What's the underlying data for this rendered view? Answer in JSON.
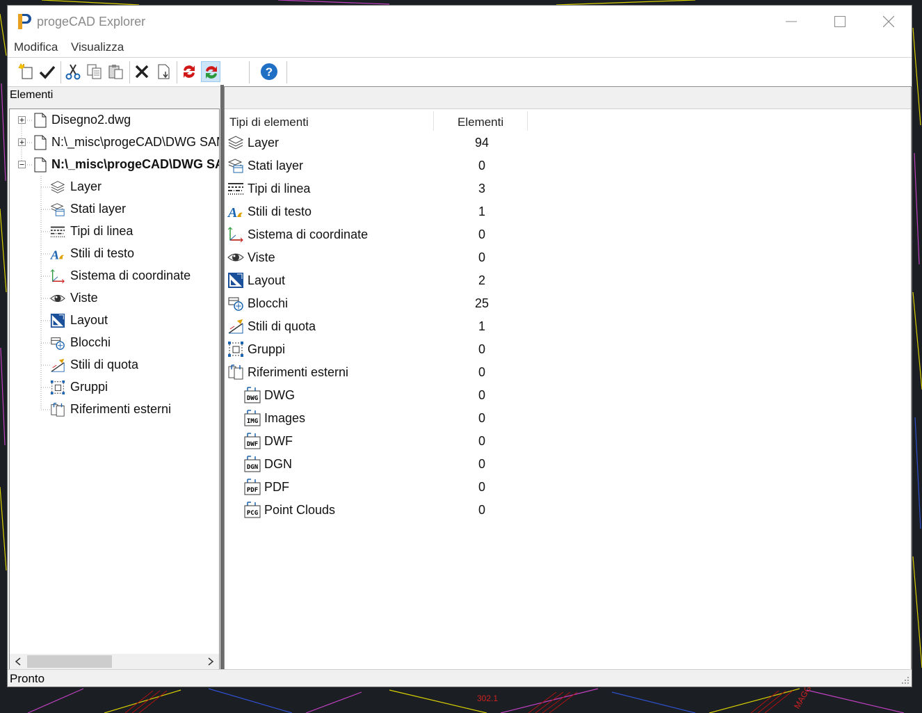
{
  "window": {
    "title": "progeCAD Explorer"
  },
  "menu": [
    "Modifica",
    "Visualizza"
  ],
  "toolbar": {
    "buttons": [
      {
        "name": "new-icon"
      },
      {
        "name": "check-icon"
      },
      {
        "name": "cut-icon"
      },
      {
        "name": "copy-icon"
      },
      {
        "name": "paste-icon"
      },
      {
        "name": "delete-icon"
      },
      {
        "name": "purge-icon"
      },
      {
        "name": "refresh-icon"
      },
      {
        "name": "sync-icon"
      },
      {
        "name": "help-icon"
      }
    ]
  },
  "left_panel": {
    "header": "Elementi",
    "documents": [
      {
        "label": "Disegno2.dwg",
        "expanded": false,
        "bold": false
      },
      {
        "label": "N:\\_misc\\progeCAD\\DWG SAMPLES",
        "expanded": false,
        "bold": false
      },
      {
        "label": "N:\\_misc\\progeCAD\\DWG SAMPLES",
        "expanded": true,
        "bold": true
      }
    ],
    "children": [
      {
        "label": "Layer",
        "icon": "layer-icon"
      },
      {
        "label": "Stati layer",
        "icon": "layer-states-icon"
      },
      {
        "label": "Tipi di linea",
        "icon": "linetype-icon"
      },
      {
        "label": "Stili di testo",
        "icon": "text-style-icon"
      },
      {
        "label": "Sistema di coordinate",
        "icon": "ucs-icon"
      },
      {
        "label": "Viste",
        "icon": "eye-icon"
      },
      {
        "label": "Layout",
        "icon": "layout-icon"
      },
      {
        "label": "Blocchi",
        "icon": "block-icon"
      },
      {
        "label": "Stili di quota",
        "icon": "dimstyle-icon"
      },
      {
        "label": "Gruppi",
        "icon": "group-icon"
      },
      {
        "label": "Riferimenti esterni",
        "icon": "xref-icon"
      }
    ]
  },
  "right_panel": {
    "columns": [
      "Tipi di elementi",
      "Elementi"
    ],
    "rows": [
      {
        "label": "Layer",
        "count": "94",
        "icon": "layer-icon",
        "indent": 0
      },
      {
        "label": "Stati layer",
        "count": "0",
        "icon": "layer-states-icon",
        "indent": 0
      },
      {
        "label": "Tipi di linea",
        "count": "3",
        "icon": "linetype-icon",
        "indent": 0
      },
      {
        "label": "Stili di testo",
        "count": "1",
        "icon": "text-style-icon",
        "indent": 0
      },
      {
        "label": "Sistema di coordinate",
        "count": "0",
        "icon": "ucs-icon",
        "indent": 0
      },
      {
        "label": "Viste",
        "count": "0",
        "icon": "eye-icon",
        "indent": 0
      },
      {
        "label": "Layout",
        "count": "2",
        "icon": "layout-icon",
        "indent": 0
      },
      {
        "label": "Blocchi",
        "count": "25",
        "icon": "block-icon",
        "indent": 0
      },
      {
        "label": "Stili di quota",
        "count": "1",
        "icon": "dimstyle-icon",
        "indent": 0
      },
      {
        "label": "Gruppi",
        "count": "0",
        "icon": "group-icon",
        "indent": 0
      },
      {
        "label": "Riferimenti esterni",
        "count": "0",
        "icon": "xref-icon",
        "indent": 0
      },
      {
        "label": "DWG",
        "count": "0",
        "icon": "dwg-file-icon",
        "badge": "DWG",
        "indent": 1
      },
      {
        "label": "Images",
        "count": "0",
        "icon": "image-file-icon",
        "badge": "IMG",
        "indent": 1
      },
      {
        "label": "DWF",
        "count": "0",
        "icon": "dwf-file-icon",
        "badge": "DWF",
        "indent": 1
      },
      {
        "label": "DGN",
        "count": "0",
        "icon": "dgn-file-icon",
        "badge": "DGN",
        "indent": 1
      },
      {
        "label": "PDF",
        "count": "0",
        "icon": "pdf-file-icon",
        "badge": "PDF",
        "indent": 1
      },
      {
        "label": "Point Clouds",
        "count": "0",
        "icon": "pointcloud-file-icon",
        "badge": "PCG",
        "indent": 1
      }
    ]
  },
  "status": {
    "text": "Pronto"
  },
  "background_labels": [
    "302.1",
    "MAGG"
  ],
  "colors": {
    "accent_blue": "#1a64b0",
    "accent_red": "#d01818",
    "help_blue": "#1f6fc5"
  }
}
